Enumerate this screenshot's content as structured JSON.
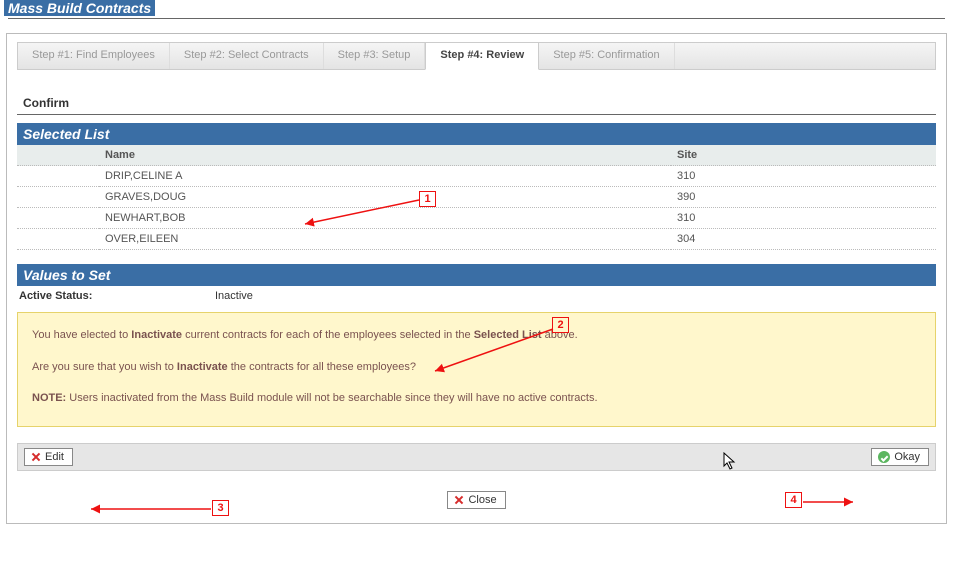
{
  "page": {
    "title": "Mass Build Contracts"
  },
  "tabs": [
    {
      "label": "Step #1: Find Employees",
      "active": false
    },
    {
      "label": "Step #2: Select Contracts",
      "active": false
    },
    {
      "label": "Step #3: Setup",
      "active": false
    },
    {
      "label": "Step #4: Review",
      "active": true
    },
    {
      "label": "Step #5: Confirmation",
      "active": false
    }
  ],
  "confirm_label": "Confirm",
  "selected_list": {
    "title": "Selected List",
    "columns": {
      "name": "Name",
      "site": "Site"
    },
    "rows": [
      {
        "name": "DRIP,CELINE A",
        "site": "310"
      },
      {
        "name": "GRAVES,DOUG",
        "site": "390"
      },
      {
        "name": "NEWHART,BOB",
        "site": "310"
      },
      {
        "name": "OVER,EILEEN",
        "site": "304"
      }
    ]
  },
  "values_to_set": {
    "title": "Values to Set",
    "active_status_label": "Active Status:",
    "active_status_value": "Inactive"
  },
  "warning": {
    "line1_pre": "You have elected to ",
    "line1_bold1": "Inactivate",
    "line1_mid": " current contracts for each of the employees selected in the ",
    "line1_bold2": "Selected List",
    "line1_post": " above.",
    "line2_pre": "Are you sure that you wish to ",
    "line2_bold": "Inactivate",
    "line2_post": " the contracts for all these employees?",
    "note_label": "NOTE:",
    "note_text": " Users inactivated from the Mass Build module will not be searchable since they will have no active contracts."
  },
  "buttons": {
    "edit": "Edit",
    "okay": "Okay",
    "close": "Close"
  },
  "annotations": {
    "n1": "1",
    "n2": "2",
    "n3": "3",
    "n4": "4"
  }
}
